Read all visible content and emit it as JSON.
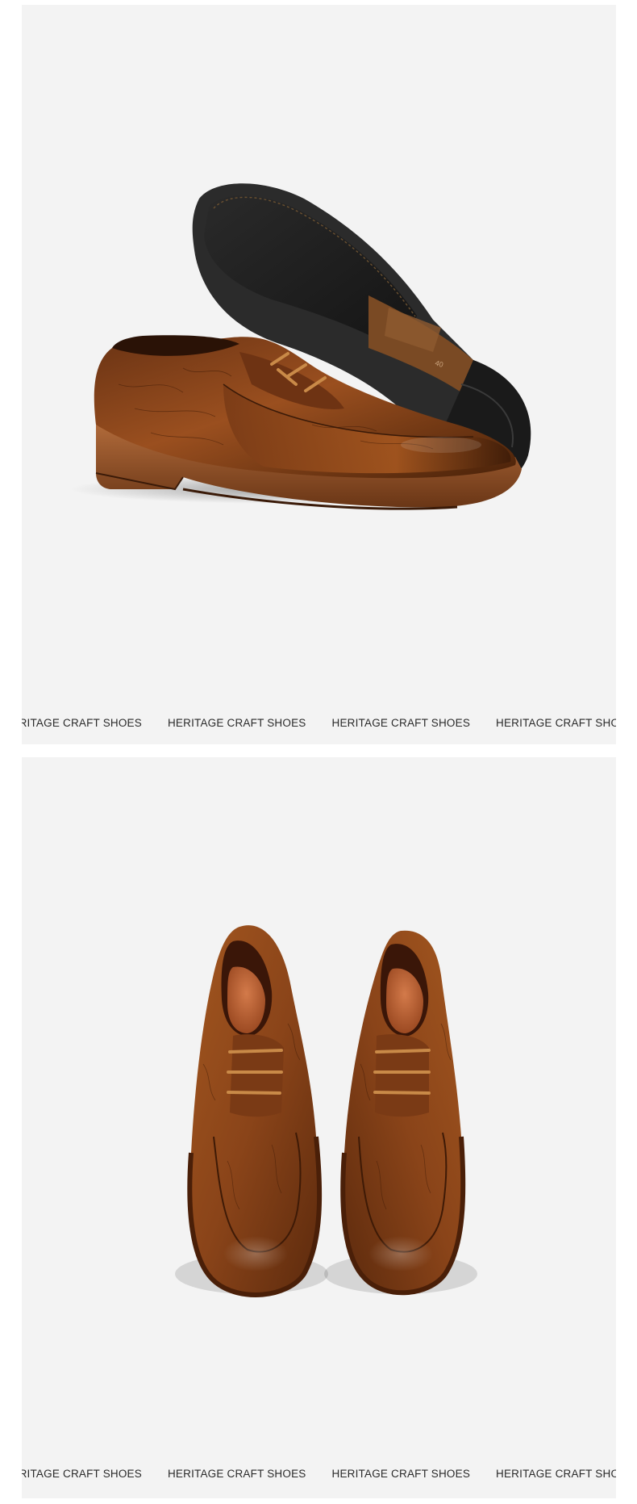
{
  "panels": [
    {
      "caption": {
        "items": [
          "HERITAGE CRAFT SHOES",
          "HERITAGE CRAFT SHOES",
          "HERITAGE CRAFT SHOES",
          "HERITAGE CRAFT SHOES"
        ]
      },
      "image_subject": "leather-derby-shoe-side-and-sole-view",
      "sole_size_mark": "40"
    },
    {
      "caption": {
        "items": [
          "HERITAGE CRAFT SHOES",
          "HERITAGE CRAFT SHOES",
          "HERITAGE CRAFT SHOES",
          "HERITAGE CRAFT SHOES"
        ]
      },
      "image_subject": "leather-derby-shoes-pair-top-view"
    }
  ],
  "colors": {
    "background": "#ffffff",
    "panel": "#f3f3f3",
    "leather_dark": "#5a2e14",
    "leather_mid": "#8c4a1e",
    "leather_light": "#b8692c",
    "sole_black": "#1e1e1e",
    "heel_brown": "#6e3a18",
    "caption_text": "#2a2a2a"
  }
}
